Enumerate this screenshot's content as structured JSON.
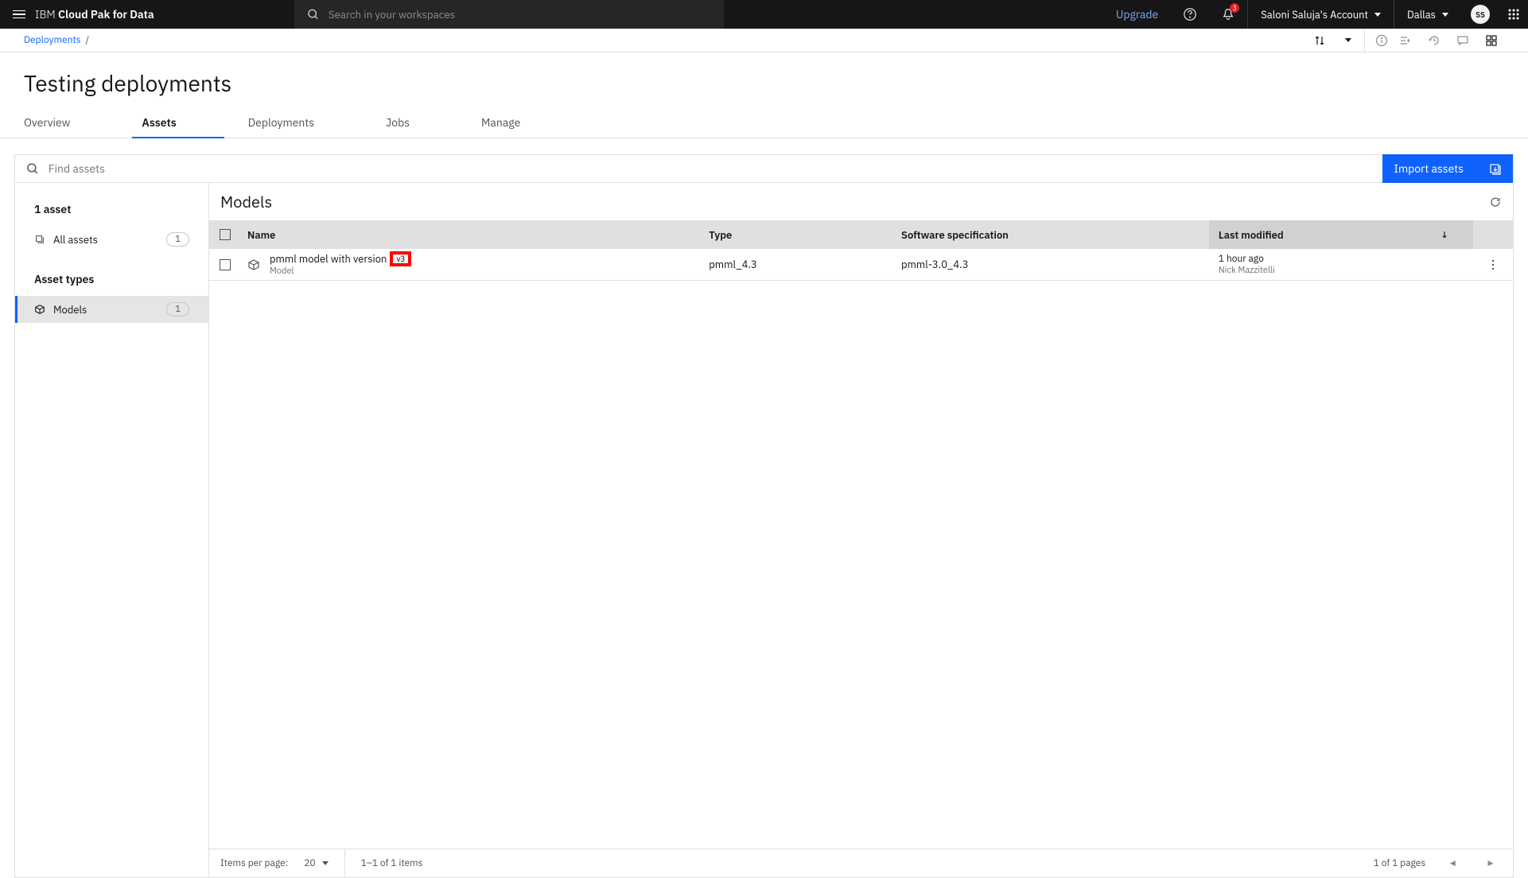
{
  "header": {
    "brand_prefix": "IBM",
    "brand_bold": "Cloud Pak for Data",
    "search_placeholder": "Search in your workspaces",
    "upgrade_label": "Upgrade",
    "notification_count": "3",
    "account_label": "Saloni Saluja's Account",
    "region_label": "Dallas",
    "avatar_initials": "SS"
  },
  "breadcrumbs": {
    "items": [
      "Deployments"
    ],
    "separator": "/"
  },
  "page": {
    "title": "Testing deployments"
  },
  "tabs": [
    "Overview",
    "Assets",
    "Deployments",
    "Jobs",
    "Manage"
  ],
  "active_tab": "Assets",
  "filter": {
    "placeholder": "Find assets",
    "import_label": "Import assets"
  },
  "sidebar": {
    "asset_summary": "1 asset",
    "all_assets_label": "All assets",
    "all_assets_count": "1",
    "asset_types_label": "Asset types",
    "types": [
      {
        "label": "Models",
        "count": "1"
      }
    ]
  },
  "panel": {
    "title": "Models"
  },
  "table": {
    "columns": {
      "name": "Name",
      "type": "Type",
      "spec": "Software specification",
      "modified": "Last modified"
    },
    "rows": [
      {
        "name": "pmml model with version",
        "subtype": "Model",
        "version": "v3",
        "type": "pmml_4.3",
        "spec": "pmml-3.0_4.3",
        "modified_time": "1 hour ago",
        "modified_user": "Nick Mazzitelli"
      }
    ]
  },
  "pagination": {
    "items_per_page_label": "Items per page:",
    "items_per_page_value": "20",
    "range": "1–1 of 1 items",
    "page_info": "1 of 1 pages"
  }
}
